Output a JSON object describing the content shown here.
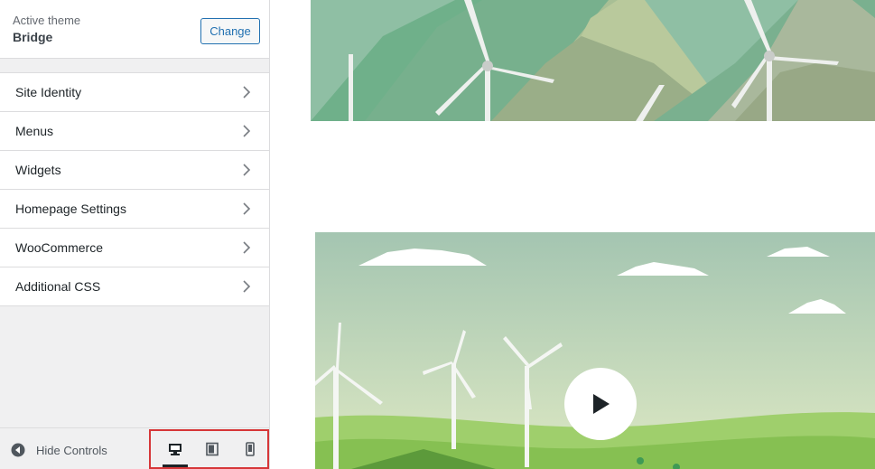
{
  "theme": {
    "label": "Active theme",
    "name": "Bridge",
    "change_label": "Change"
  },
  "menu": {
    "items": [
      {
        "label": "Site Identity"
      },
      {
        "label": "Menus"
      },
      {
        "label": "Widgets"
      },
      {
        "label": "Homepage Settings"
      },
      {
        "label": "WooCommerce"
      },
      {
        "label": "Additional CSS"
      }
    ]
  },
  "footer": {
    "hide_controls_label": "Hide Controls",
    "devices": [
      {
        "icon": "desktop-icon",
        "active": true
      },
      {
        "icon": "tablet-icon",
        "active": false
      },
      {
        "icon": "mobile-icon",
        "active": false
      }
    ]
  },
  "colors": {
    "accent": "#2271b1",
    "highlight": "#d63638"
  }
}
